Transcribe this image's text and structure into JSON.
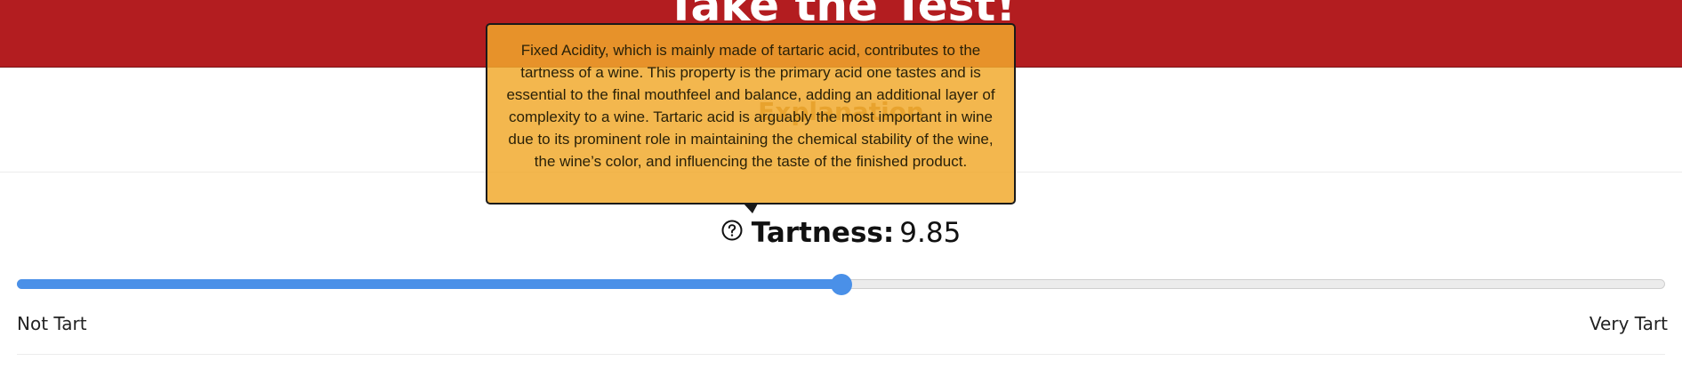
{
  "header": {
    "title": "Take the Test!"
  },
  "explanation": {
    "heading": "Explanation"
  },
  "tooltip": {
    "text": "Fixed Acidity, which is mainly made of tartaric acid, contributes to the tartness of a wine. This property is the primary acid one tastes and is essential to the final mouthfeel and balance, adding an additional layer of complexity to a wine. Tartaric acid is arguably the most important in wine due to its prominent role in maintaining the chemical stability of the wine, the wine’s color, and influencing the taste of the finished product."
  },
  "tartness": {
    "label": "Tartness:",
    "value": "9.85",
    "help_icon": "question-circle-icon"
  },
  "slider": {
    "min_label": "Not Tart",
    "max_label": "Very Tart",
    "fraction": 0.5,
    "fill_color": "#4a90e8"
  },
  "colors": {
    "header_bg": "#b31d20",
    "tooltip_bg": "#f1a92c",
    "accent": "#4a90e8"
  }
}
